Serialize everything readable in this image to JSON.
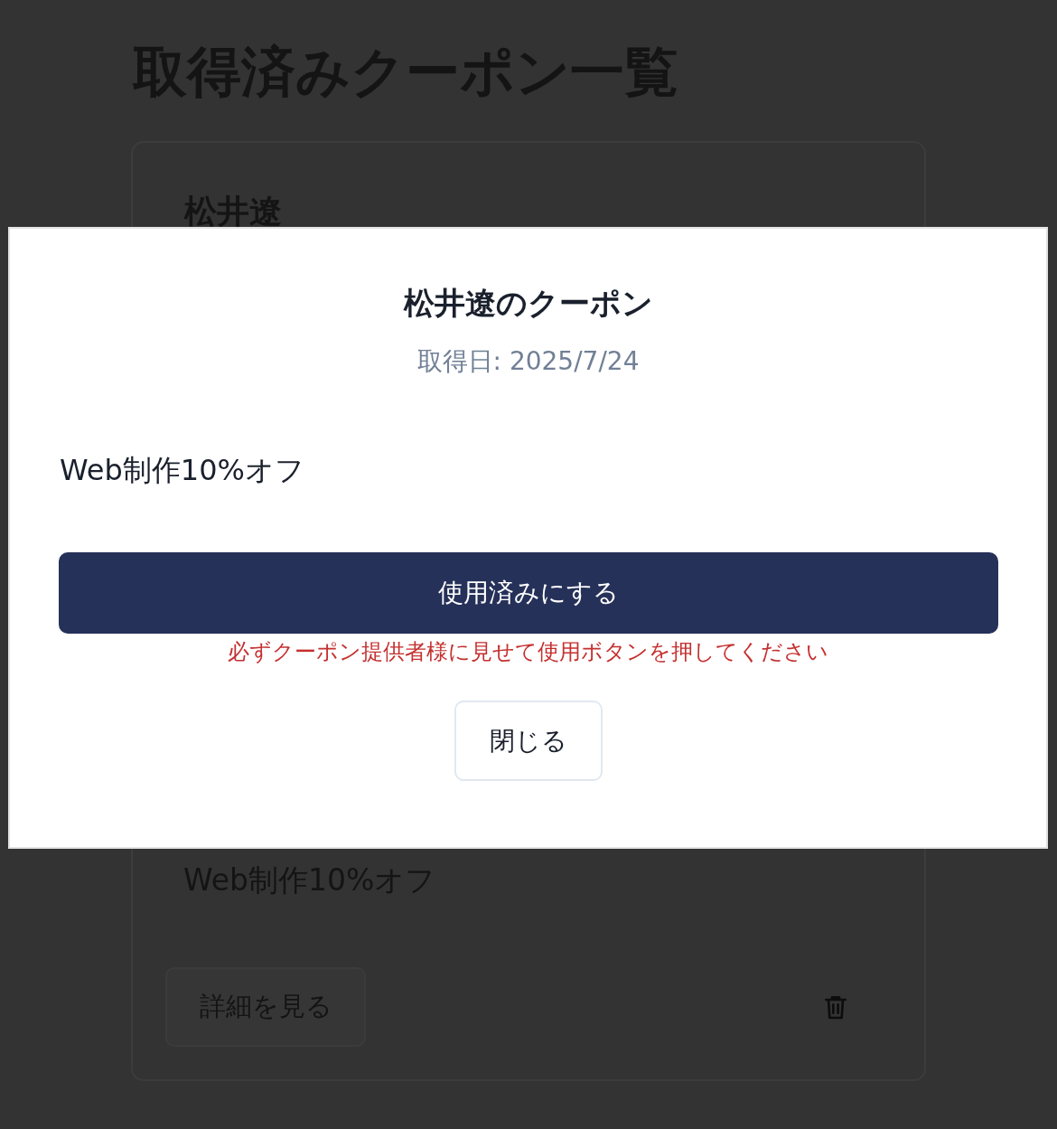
{
  "page": {
    "title": "取得済みクーポン一覧"
  },
  "coupon_card": {
    "title": "松井遼",
    "description": "Web制作10%オフ",
    "details_button": "詳細を見る"
  },
  "modal": {
    "title": "松井遼のクーポン",
    "acquired_date": "取得日: 2025/7/24",
    "description": "Web制作10%オフ",
    "use_button": "使用済みにする",
    "notice": "必ずクーポン提供者様に見せて使用ボタンを押してください",
    "close_button": "閉じる"
  }
}
